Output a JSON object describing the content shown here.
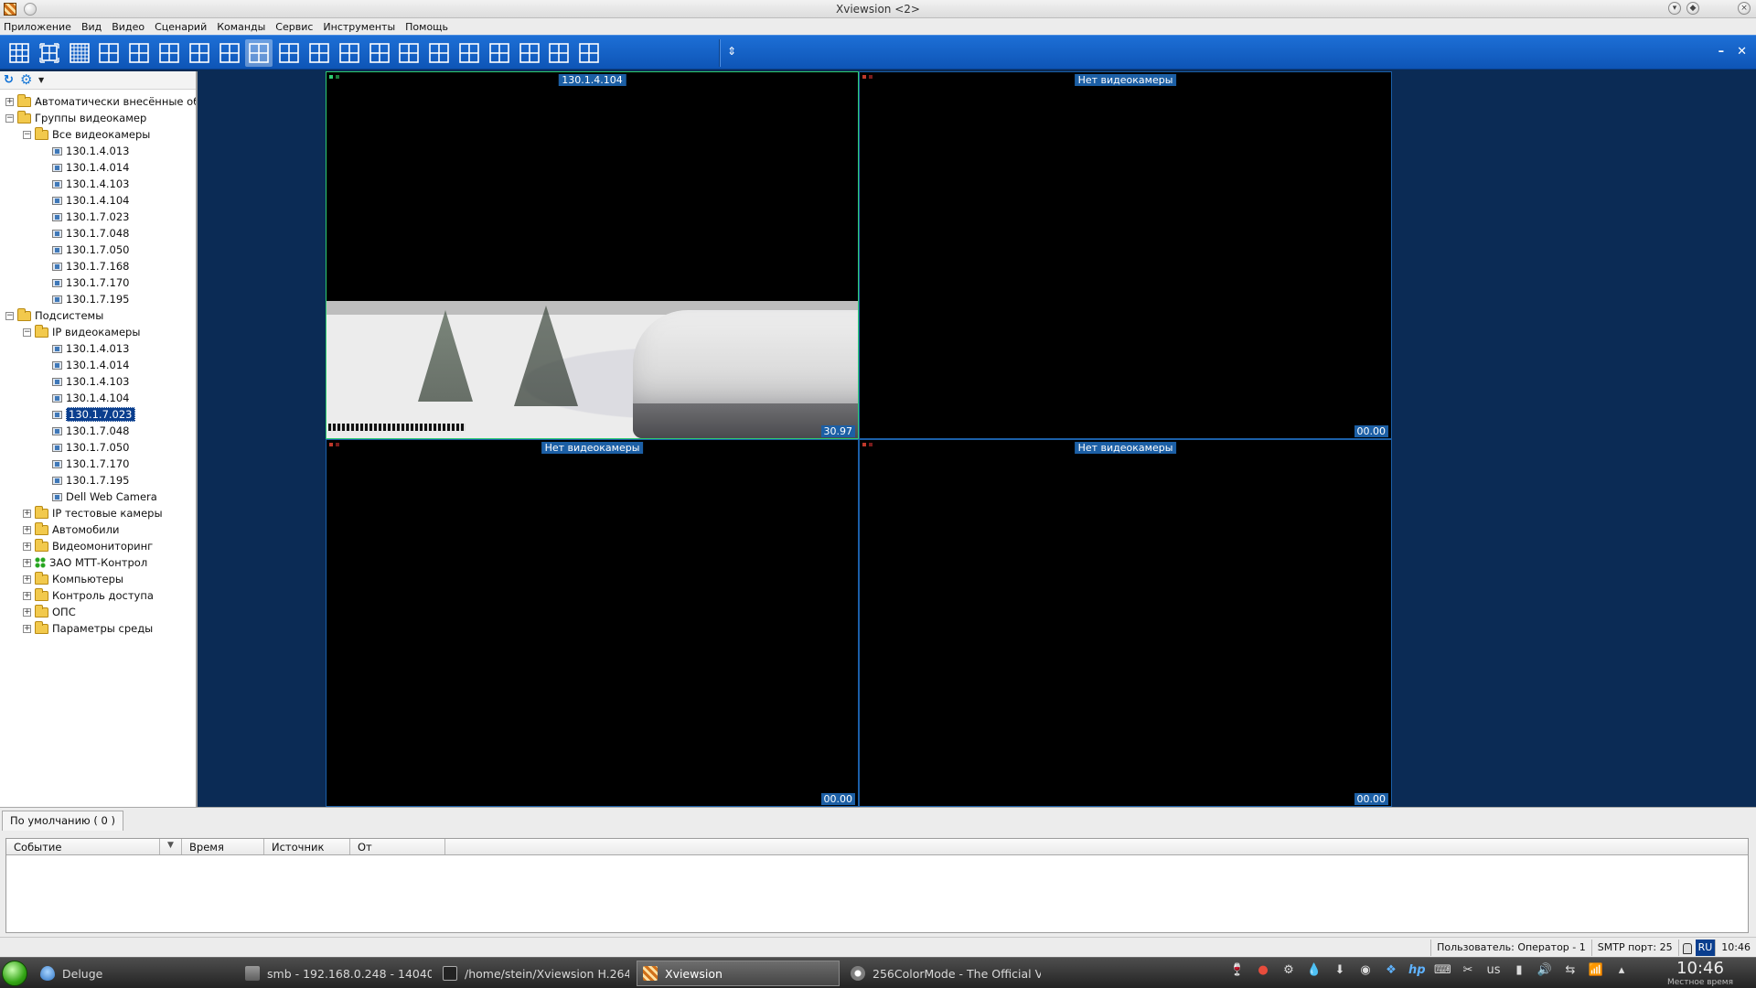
{
  "window": {
    "title": "Xviewsion <2>"
  },
  "menu": [
    "Приложение",
    "Вид",
    "Видео",
    "Сценарий",
    "Команды",
    "Сервис",
    "Инструменты",
    "Помощь"
  ],
  "tree": {
    "auto_objects": "Автоматически внесённые объ",
    "groups": "Группы видеокамер",
    "all_cameras": "Все видеокамеры",
    "all_cameras_items": [
      "130.1.4.013",
      "130.1.4.014",
      "130.1.4.103",
      "130.1.4.104",
      "130.1.7.023",
      "130.1.7.048",
      "130.1.7.050",
      "130.1.7.168",
      "130.1.7.170",
      "130.1.7.195"
    ],
    "subsystems": "Подсистемы",
    "ip_cameras": "IP видеокамеры",
    "ip_cameras_items": [
      "130.1.4.013",
      "130.1.4.014",
      "130.1.4.103",
      "130.1.4.104",
      "130.1.7.023",
      "130.1.7.048",
      "130.1.7.050",
      "130.1.7.170",
      "130.1.7.195",
      "Dell Web Camera"
    ],
    "selected_item": "130.1.7.023",
    "other_folders": [
      "IP тестовые камеры",
      "Автомобили",
      "Видеомониторинг",
      "ЗАО МТТ-Контрол",
      "Компьютеры",
      "Контроль доступа",
      "ОПС",
      "Параметры среды"
    ]
  },
  "tiles": [
    {
      "title": "130.1.4.104",
      "fps": "30.97"
    },
    {
      "title": "Нет видеокамеры",
      "fps": "00.00"
    },
    {
      "title": "Нет видеокамеры",
      "fps": "00.00"
    },
    {
      "title": "Нет видеокамеры",
      "fps": "00.00"
    }
  ],
  "events": {
    "tab": "По умолчанию ( 0 )",
    "columns": [
      "Событие",
      "Время",
      "Источник",
      "От"
    ]
  },
  "status": {
    "user": "Пользователь: Оператор - 1",
    "smtp": "SMTP порт: 25",
    "lang": "RU",
    "time": "10:46"
  },
  "taskbar": {
    "tasks": [
      "Deluge",
      "smb - 192.168.0.248 - 14040",
      "/home/stein/Xviewsion H.264",
      "Xviewsion",
      "256ColorMode - The Official V"
    ],
    "keyboard": "us",
    "clock_time": "10:46",
    "clock_label": "Местное время"
  },
  "colors": {
    "toolbar": "#1465c8",
    "workspace": "#0b2b55",
    "selection": "#0a3e8e",
    "active_tile_border": "#2ecc71"
  }
}
